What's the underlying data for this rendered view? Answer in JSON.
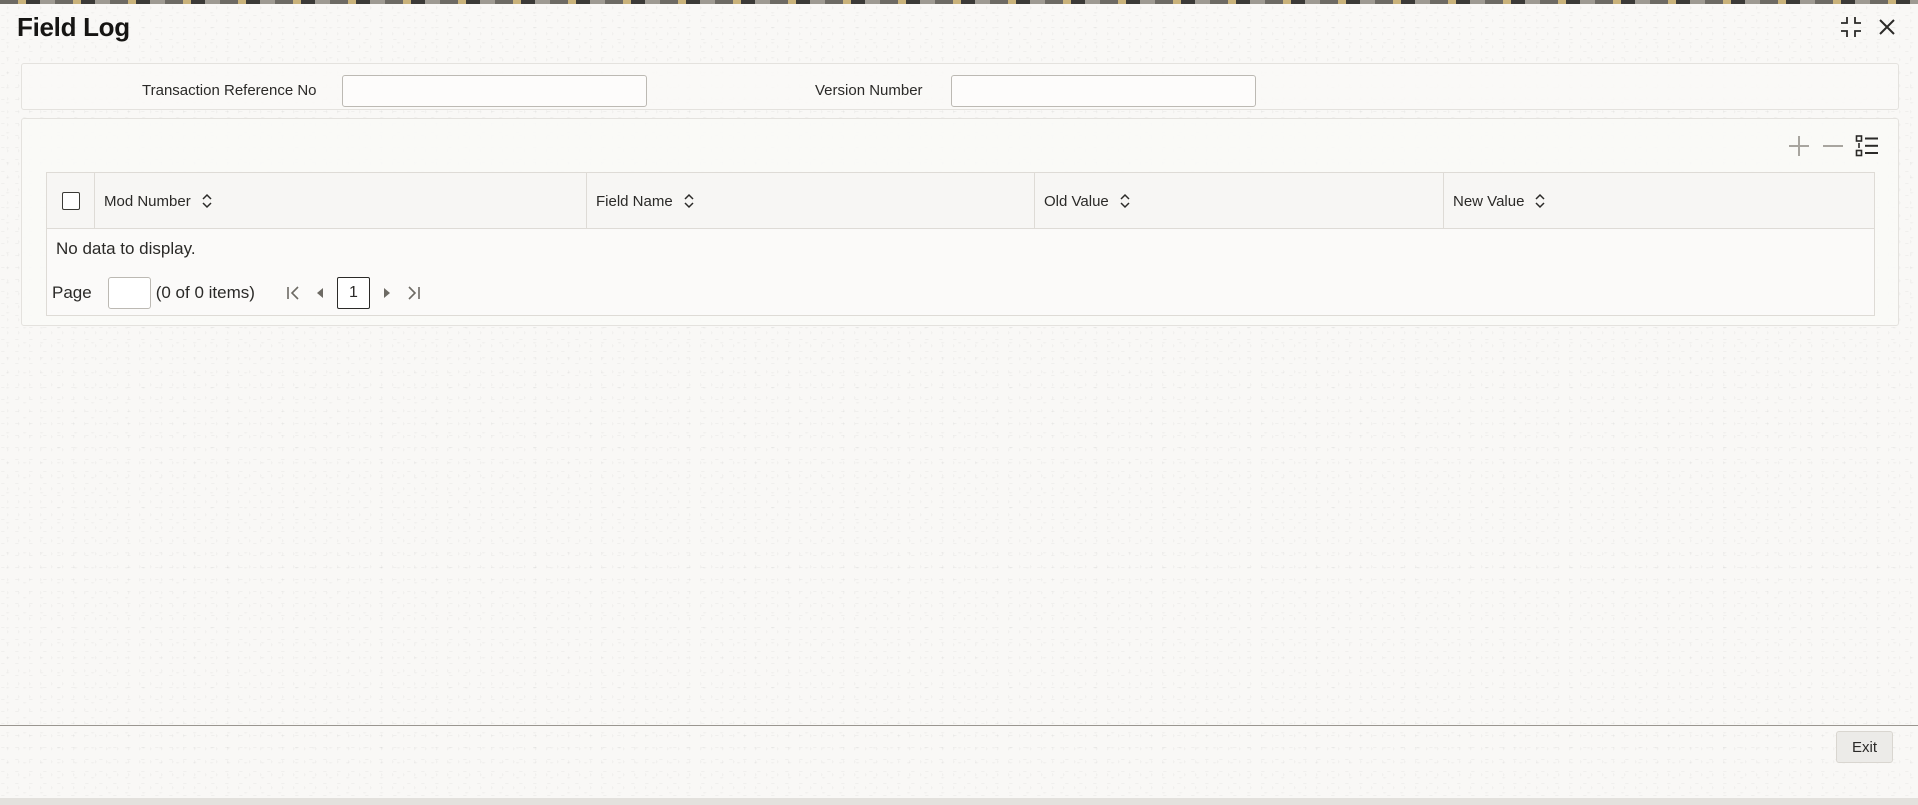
{
  "window": {
    "title": "Field Log",
    "controls": [
      {
        "icon": "minimize-icon"
      },
      {
        "icon": "close-icon"
      }
    ]
  },
  "header": {
    "transaction_ref_label": "Transaction Reference No",
    "transaction_ref_value": "",
    "version_number_label": "Version Number",
    "version_number_value": ""
  },
  "grid": {
    "toolbar": [
      {
        "icon": "add-icon"
      },
      {
        "icon": "remove-icon"
      },
      {
        "icon": "column-list-icon"
      }
    ],
    "columns": [
      {
        "label": "Mod Number"
      },
      {
        "label": "Field Name"
      },
      {
        "label": "Old Value"
      },
      {
        "label": "New Value"
      }
    ],
    "rows": [],
    "empty_message": "No data to display.",
    "pagination": {
      "page_label": "Page",
      "page_input": "",
      "items_text": "(0 of 0 items)",
      "current_page": "1"
    }
  },
  "footer": {
    "exit_label": "Exit"
  },
  "colors": {
    "text": "#161513",
    "border": "#dedbd6",
    "background": "#f9f8f6"
  }
}
